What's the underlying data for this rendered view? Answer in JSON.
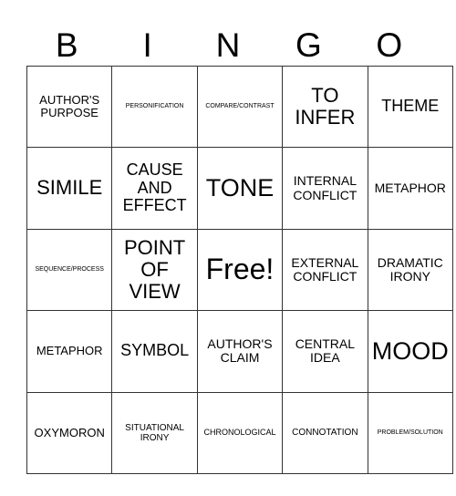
{
  "header": {
    "letters": [
      "B",
      "I",
      "N",
      "G",
      "O"
    ]
  },
  "grid": {
    "rows": [
      [
        "AUTHOR'S PURPOSE",
        "PERSONIFICATION",
        "COMPARE/CONTRAST",
        "TO INFER",
        "THEME"
      ],
      [
        "SIMILE",
        "CAUSE AND EFFECT",
        "TONE",
        "INTERNAL CONFLICT",
        "METAPHOR"
      ],
      [
        "SEQUENCE/PROCESS",
        "POINT OF VIEW",
        "Free!",
        "EXTERNAL CONFLICT",
        "DRAMATIC IRONY"
      ],
      [
        "METAPHOR",
        "SYMBOL",
        "AUTHOR'S CLAIM",
        "CENTRAL IDEA",
        "MOOD"
      ],
      [
        "OXYMORON",
        "SITUATIONAL IRONY",
        "CHRONOLOGICAL",
        "CONNOTATION",
        "PROBLEM/SOLUTION"
      ]
    ]
  }
}
